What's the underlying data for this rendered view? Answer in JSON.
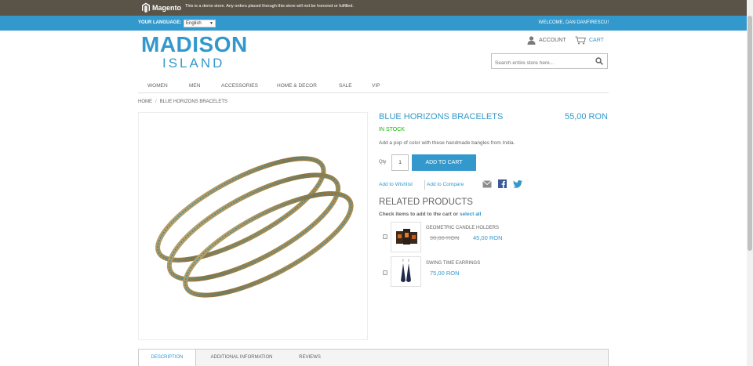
{
  "demo_bar": {
    "brand": "Magento",
    "notice": "This is a demo store. Any orders placed through this store will not be honored or fulfilled."
  },
  "header": {
    "language_label": "YOUR LANGUAGE:",
    "language_value": "English",
    "welcome": "WELCOME, DAN DANFIRESCU!",
    "logo_line1": "MADISON",
    "logo_line2": "ISLAND",
    "account_label": "ACCOUNT",
    "cart_label": "CART",
    "search_placeholder": "Search entire store here..."
  },
  "nav": {
    "items": [
      "WOMEN",
      "MEN",
      "ACCESSORIES",
      "HOME & DECOR",
      "SALE",
      "VIP"
    ]
  },
  "breadcrumb": {
    "home": "HOME",
    "separator": "/",
    "current": "BLUE HORIZONS BRACELETS"
  },
  "product": {
    "name": "BLUE HORIZONS BRACELETS",
    "price": "55,00 RON",
    "stock": "IN STOCK",
    "description": "Add a pop of color with these handmade bangles from India.",
    "qty_label": "Qty",
    "qty_value": "1",
    "add_to_cart": "ADD TO CART",
    "wishlist": "Add to Wishlist",
    "compare": "Add to Compare"
  },
  "related": {
    "title": "RELATED PRODUCTS",
    "hint": "Check items to add to the cart or",
    "select_all": "select all",
    "items": [
      {
        "name": "GEOMETRIC CANDLE HOLDERS",
        "old_price": "90,00 RON",
        "price": "45,00 RON"
      },
      {
        "name": "SWING TIME EARRINGS",
        "old_price": "",
        "price": "75,00 RON"
      }
    ]
  },
  "tabs": [
    "DESCRIPTION",
    "ADDITIONAL INFORMATION",
    "REVIEWS"
  ],
  "colors": {
    "accent": "#3399cc",
    "demo_bar": "#5a5448",
    "in_stock": "#11b400",
    "text": "#636363"
  }
}
